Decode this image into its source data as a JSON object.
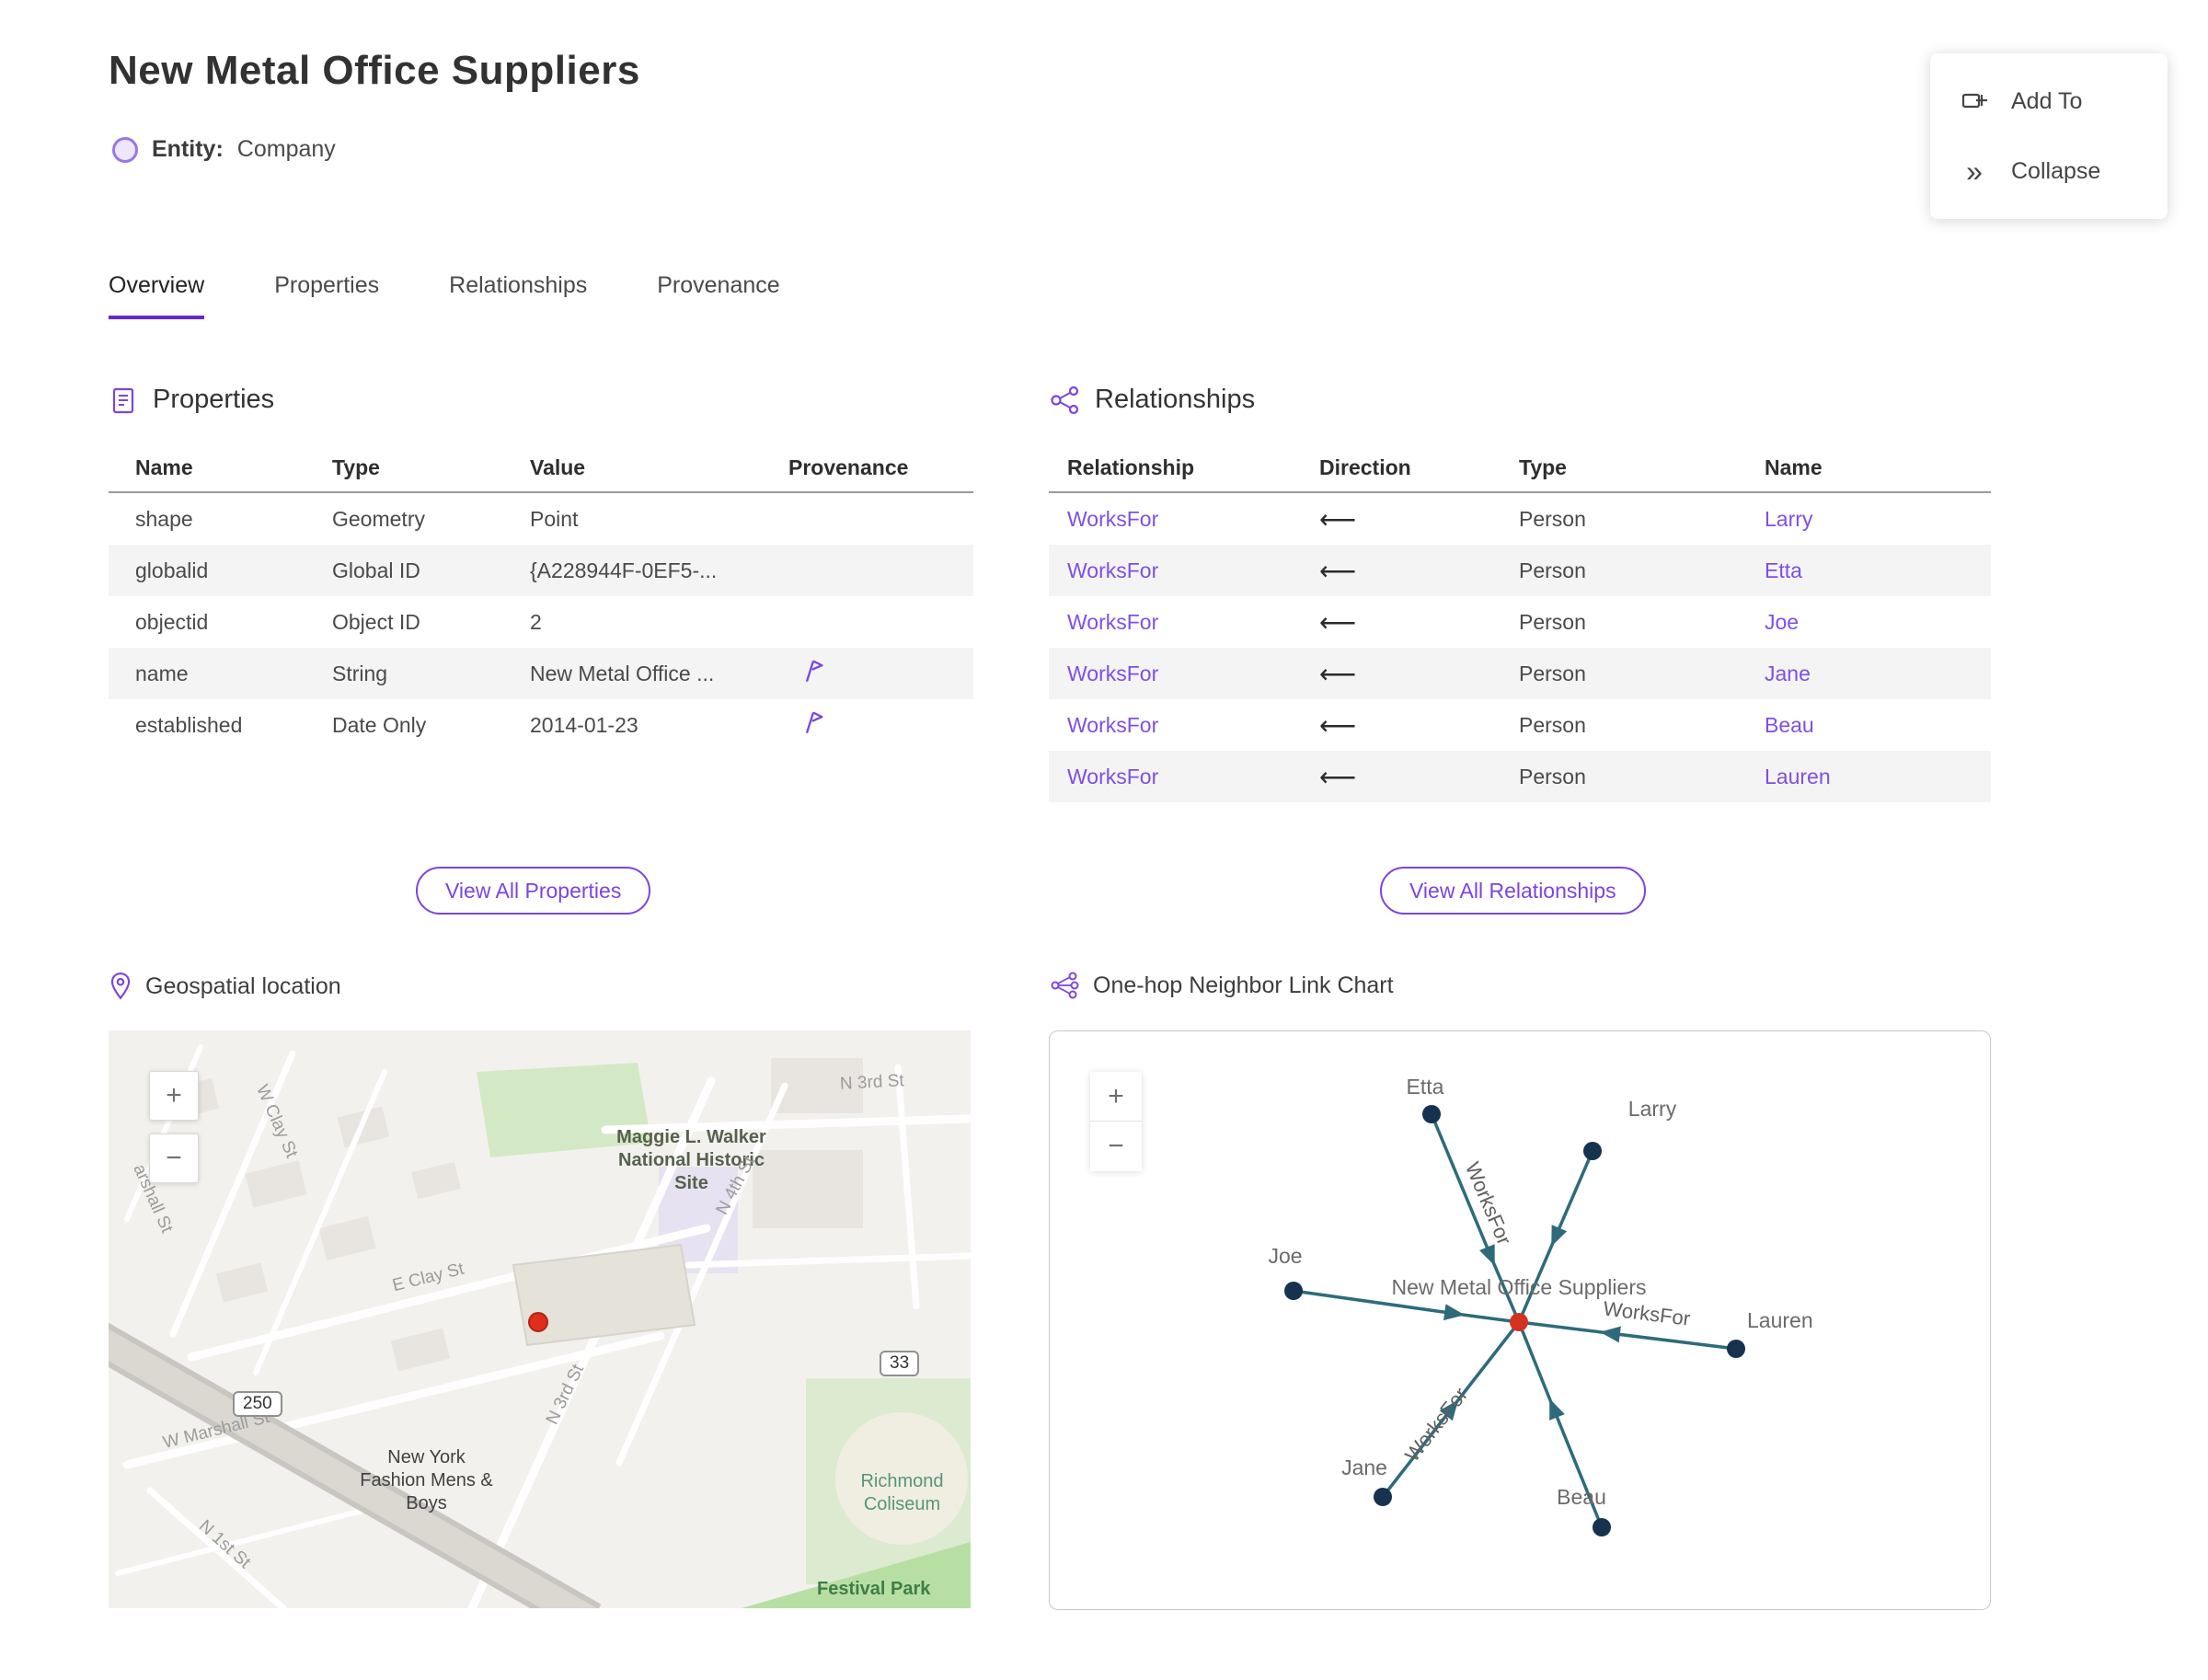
{
  "colors": {
    "accent_purple": "#7b45e0",
    "link_purple": "#7e4fe6",
    "tab_underline": "#6527cf",
    "marker_red": "#dd2f1b",
    "edge_teal": "#2e6b7a",
    "node_navy": "#16324e",
    "row_stripe": "#f4f4f4"
  },
  "header": {
    "title": "New Metal Office Suppliers",
    "entity_label": "Entity:",
    "entity_type": "Company"
  },
  "actions": {
    "add_to": "Add To",
    "collapse": "Collapse",
    "collapse_icon": "»"
  },
  "tabs": [
    {
      "label": "Overview",
      "active": true
    },
    {
      "label": "Properties",
      "active": false
    },
    {
      "label": "Relationships",
      "active": false
    },
    {
      "label": "Provenance",
      "active": false
    }
  ],
  "properties_section": {
    "title": "Properties",
    "columns": [
      "Name",
      "Type",
      "Value",
      "Provenance"
    ],
    "rows": [
      {
        "name": "shape",
        "type": "Geometry",
        "value": "Point",
        "has_provenance": false
      },
      {
        "name": "globalid",
        "type": "Global ID",
        "value": "{A228944F-0EF5-...",
        "has_provenance": false
      },
      {
        "name": "objectid",
        "type": "Object ID",
        "value": "2",
        "has_provenance": false
      },
      {
        "name": "name",
        "type": "String",
        "value": "New Metal Office ...",
        "has_provenance": true
      },
      {
        "name": "established",
        "type": "Date Only",
        "value": "2014-01-23",
        "has_provenance": true
      }
    ],
    "view_all_label": "View All Properties"
  },
  "relationships_section": {
    "title": "Relationships",
    "columns": [
      "Relationship",
      "Direction",
      "Type",
      "Name"
    ],
    "rows": [
      {
        "relationship": "WorksFor",
        "direction": "⟵",
        "type": "Person",
        "name": "Larry"
      },
      {
        "relationship": "WorksFor",
        "direction": "⟵",
        "type": "Person",
        "name": "Etta"
      },
      {
        "relationship": "WorksFor",
        "direction": "⟵",
        "type": "Person",
        "name": "Joe"
      },
      {
        "relationship": "WorksFor",
        "direction": "⟵",
        "type": "Person",
        "name": "Jane"
      },
      {
        "relationship": "WorksFor",
        "direction": "⟵",
        "type": "Person",
        "name": "Beau"
      },
      {
        "relationship": "WorksFor",
        "direction": "⟵",
        "type": "Person",
        "name": "Lauren"
      }
    ],
    "view_all_label": "View All Relationships"
  },
  "map_section": {
    "title": "Geospatial location",
    "zoom_in": "+",
    "zoom_out": "−",
    "shields": {
      "us250": "250",
      "va33": "33"
    },
    "labels": {
      "historic_site": "Maggie L. Walker National Historic Site",
      "n3rd_top": "N 3rd St",
      "n4th": "N 4th St",
      "n3rd_mid": "N 3rd St",
      "e_clay": "E Clay St",
      "w_clay": "W Clay St",
      "marshall_partial": "arshall St",
      "w_marshall": "W Marshall St",
      "n1st": "N 1st St",
      "ny_fashion": "New York Fashion Mens & Boys",
      "coliseum": "Richmond Coliseum",
      "festival_park": "Festival Park"
    }
  },
  "link_chart": {
    "title": "One-hop Neighbor Link Chart",
    "zoom_in": "+",
    "zoom_out": "−",
    "center_label": "New Metal Office Suppliers",
    "edge_label": "WorksFor",
    "nodes": [
      {
        "name": "Etta"
      },
      {
        "name": "Larry"
      },
      {
        "name": "Joe"
      },
      {
        "name": "Lauren"
      },
      {
        "name": "Jane"
      },
      {
        "name": "Beau"
      }
    ]
  }
}
